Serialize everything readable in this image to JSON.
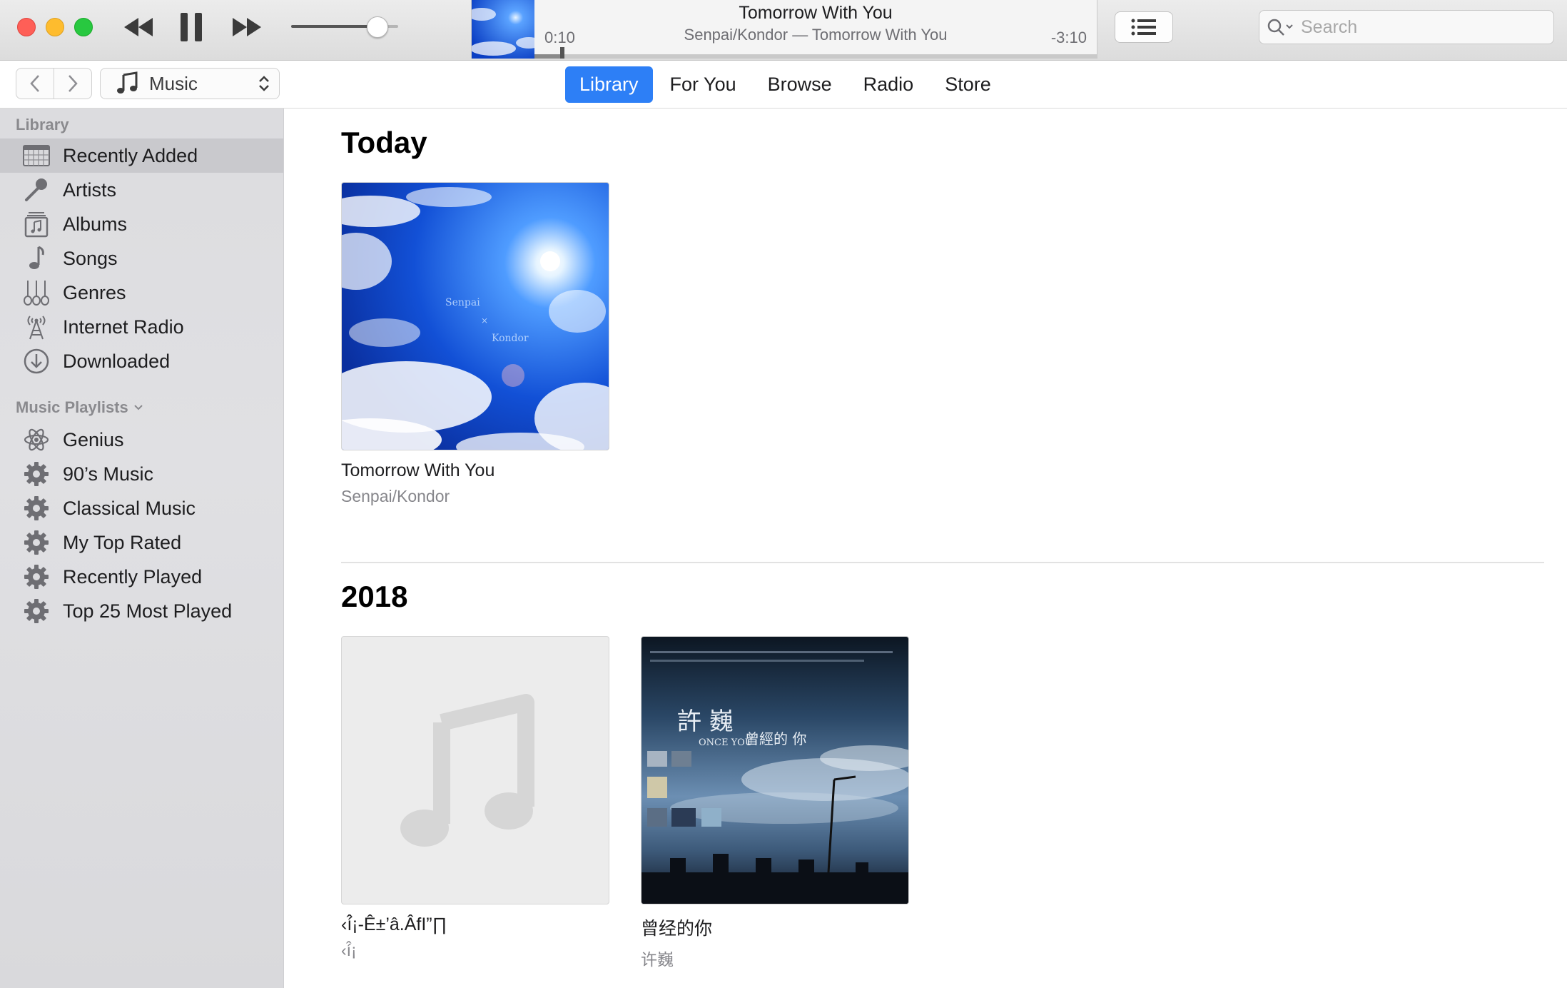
{
  "player": {
    "now_playing_title": "Tomorrow With You",
    "now_playing_subtitle": "Senpai/Kondor — Tomorrow With You",
    "elapsed": "0:10",
    "remaining": "-3:10",
    "progress_fraction": 0.05,
    "volume_fraction": 0.8
  },
  "search": {
    "placeholder": "Search"
  },
  "nav": {
    "media_kind": "Music",
    "tabs": [
      {
        "label": "Library",
        "active": true
      },
      {
        "label": "For You",
        "active": false
      },
      {
        "label": "Browse",
        "active": false
      },
      {
        "label": "Radio",
        "active": false
      },
      {
        "label": "Store",
        "active": false
      }
    ]
  },
  "sidebar": {
    "library_header": "Library",
    "library_items": [
      {
        "label": "Recently Added",
        "icon": "calendar-grid-icon",
        "selected": true
      },
      {
        "label": "Artists",
        "icon": "microphone-icon",
        "selected": false
      },
      {
        "label": "Albums",
        "icon": "album-icon",
        "selected": false
      },
      {
        "label": "Songs",
        "icon": "music-note-icon",
        "selected": false
      },
      {
        "label": "Genres",
        "icon": "guitars-icon",
        "selected": false
      },
      {
        "label": "Internet Radio",
        "icon": "antenna-icon",
        "selected": false
      },
      {
        "label": "Downloaded",
        "icon": "download-circle-icon",
        "selected": false
      }
    ],
    "playlists_header": "Music Playlists",
    "playlist_items": [
      {
        "label": "Genius",
        "icon": "atom-icon"
      },
      {
        "label": "90’s Music",
        "icon": "gear-icon"
      },
      {
        "label": "Classical Music",
        "icon": "gear-icon"
      },
      {
        "label": "My Top Rated",
        "icon": "gear-icon"
      },
      {
        "label": "Recently Played",
        "icon": "gear-icon"
      },
      {
        "label": "Top 25 Most Played",
        "icon": "gear-icon"
      }
    ]
  },
  "content": {
    "sections": [
      {
        "title": "Today",
        "albums": [
          {
            "title": "Tomorrow With You",
            "artist": "Senpai/Kondor",
            "art": "sky-clouds",
            "art_text": [
              "Senpai",
              "×",
              "Kondor"
            ]
          }
        ]
      },
      {
        "title": "2018",
        "albums": [
          {
            "title": "‹í̂¡-Ê±’â.ÂfI”∏",
            "artist": "‹í̂¡",
            "art": "placeholder-note"
          },
          {
            "title": "曾经的你",
            "artist": "许巍",
            "art": "once-you-cover",
            "art_text": [
              "許 巍",
              "曾經的 你",
              "ONCE YOU"
            ]
          }
        ]
      }
    ]
  },
  "colors": {
    "accent": "#2d7ff6",
    "close": "#fe5f57",
    "minimize": "#febc2e",
    "maximize": "#28c840",
    "sidebar_bg": "#dcdcdf",
    "selected_row": "#c9c9cd"
  }
}
